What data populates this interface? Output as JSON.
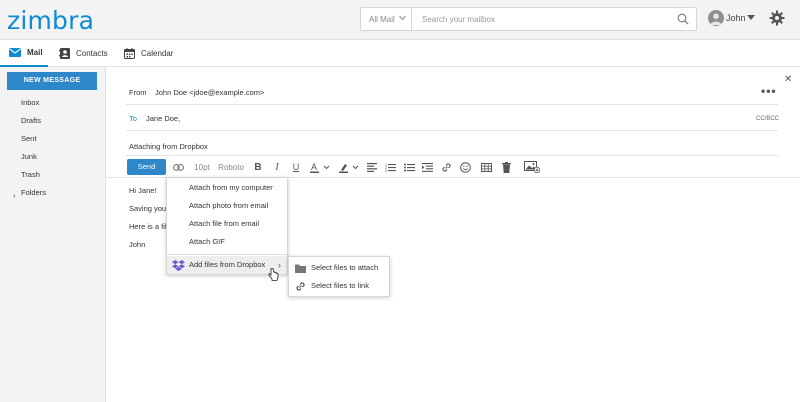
{
  "header": {
    "logo": "zimbra",
    "search_scope": "All Mail",
    "search_placeholder": "Search your mailbox",
    "user_name": "John"
  },
  "tabs": [
    {
      "label": "Mail"
    },
    {
      "label": "Contacts"
    },
    {
      "label": "Calendar"
    }
  ],
  "sidebar": {
    "new_message": "NEW MESSAGE",
    "folders": [
      "Inbox",
      "Drafts",
      "Sent",
      "Junk",
      "Trash"
    ],
    "folders_group": "Folders"
  },
  "compose": {
    "from_label": "From",
    "from_value": "John Doe <jdoe@example.com>",
    "to_label": "To",
    "to_value": "Jane Doe,",
    "cc_bcc": "CC/BCC",
    "subject": "Attaching from Dropbox",
    "send": "Send",
    "font_size": "10pt",
    "font_family": "Roboto",
    "body_lines": [
      "Hi Jane!",
      "Saving your",
      "Here is a fil",
      "John"
    ]
  },
  "attach_menu": {
    "items": [
      "Attach from my computer",
      "Attach photo from email",
      "Attach file from email",
      "Attach GIF"
    ],
    "dropbox": "Add files from Dropbox"
  },
  "dropbox_submenu": {
    "items": [
      "Select files to attach",
      "Select files to link"
    ]
  },
  "colors": {
    "brand": "#0f8bd2",
    "button": "#2e87c9",
    "dropbox": "#6a5bd6"
  }
}
